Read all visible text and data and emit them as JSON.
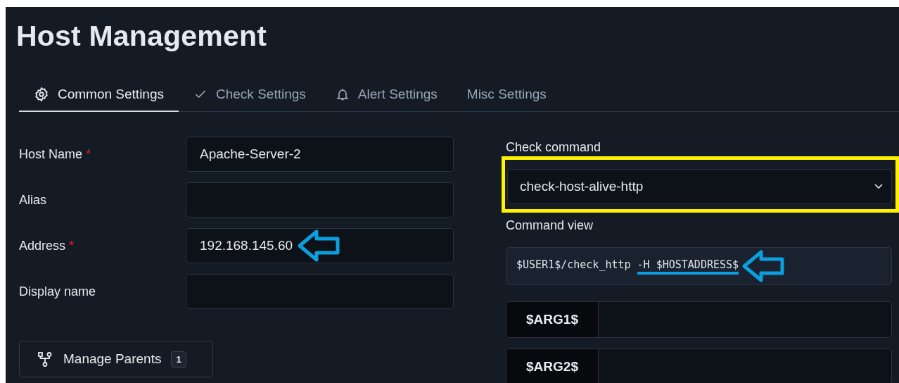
{
  "page": {
    "title": "Host Management"
  },
  "tabs": [
    {
      "label": "Common Settings",
      "selected": true
    },
    {
      "label": "Check Settings",
      "selected": false
    },
    {
      "label": "Alert Settings",
      "selected": false
    },
    {
      "label": "Misc Settings",
      "selected": false
    }
  ],
  "fields": [
    {
      "label": "Host Name",
      "required_mark": "*",
      "value": "Apache-Server-2",
      "annotated": false
    },
    {
      "label": "Alias",
      "annotated": false
    },
    {
      "label": "Address",
      "required_mark": "*",
      "value": "192.168.145.60",
      "annotated": true
    },
    {
      "label": "Display name",
      "annotated": false
    }
  ],
  "manage_parents": {
    "label": "Manage Parents",
    "count": "1"
  },
  "check_command": {
    "label": "Check command",
    "value": "check-host-alive-http",
    "highlighted": true
  },
  "command_view": {
    "label": "Command view",
    "text": "$USER1$/check_http ",
    "underlined": "-H $HOSTADDRESS$",
    "annotated": true
  },
  "arguments": [
    {
      "label": "$ARG1$"
    },
    {
      "label": "$ARG2$"
    }
  ]
}
